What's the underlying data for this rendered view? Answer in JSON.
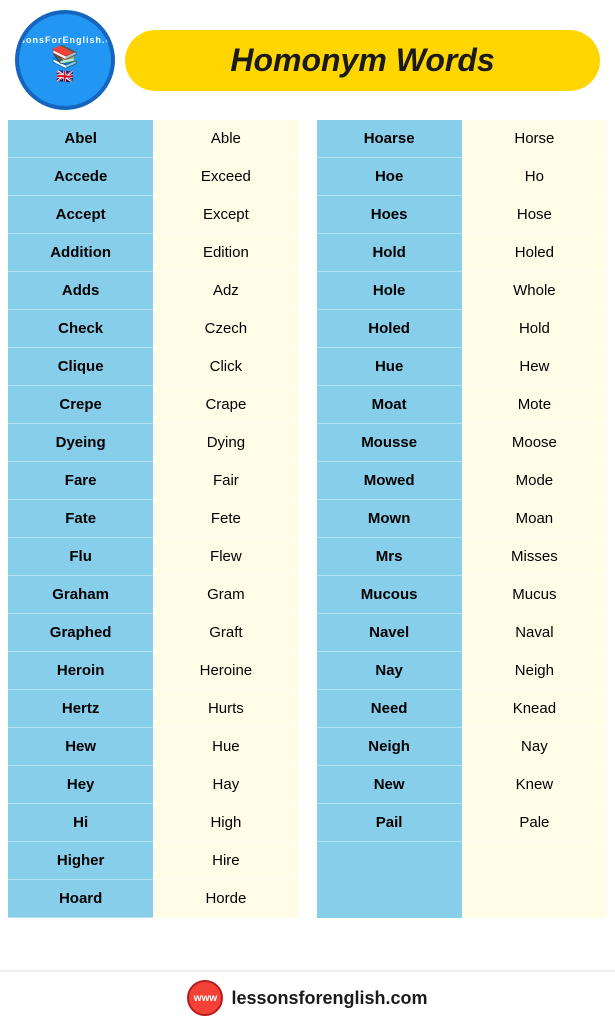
{
  "header": {
    "logo_top": "LessonsForEnglish.Com",
    "title": "Homonym Words",
    "logo_icon": "📚",
    "logo_flag": "🇬🇧"
  },
  "footer": {
    "url": "lessonsforenglish.com",
    "logo_text": "www"
  },
  "left_pair": {
    "column1": [
      "Abel",
      "Accede",
      "Accept",
      "Addition",
      "Adds",
      "Check",
      "Clique",
      "Crepe",
      "Dyeing",
      "Fare",
      "Fate",
      "Flu",
      "Graham",
      "Graphed",
      "Heroin",
      "Hertz",
      "Hew",
      "Hey",
      "Hi",
      "Higher",
      "Hoard"
    ],
    "column2": [
      "Able",
      "Exceed",
      "Except",
      "Edition",
      "Adz",
      "Czech",
      "Click",
      "Crape",
      "Dying",
      "Fair",
      "Fete",
      "Flew",
      "Gram",
      "Graft",
      "Heroine",
      "Hurts",
      "Hue",
      "Hay",
      "High",
      "Hire",
      "Horde"
    ]
  },
  "right_pair": {
    "column1": [
      "Hoarse",
      "Hoe",
      "Hoes",
      "Hold",
      "Hole",
      "Holed",
      "Hue",
      "Moat",
      "Mousse",
      "Mowed",
      "Mown",
      "Mrs",
      "Mucous",
      "Navel",
      "Nay",
      "Need",
      "Neigh",
      "New",
      "Pail"
    ],
    "column2": [
      "Horse",
      "Ho",
      "Hose",
      "Holed",
      "Whole",
      "Hold",
      "Hew",
      "Mote",
      "Moose",
      "Mode",
      "Moan",
      "Misses",
      "Mucus",
      "Naval",
      "Neigh",
      "Knead",
      "Nay",
      "Knew",
      "Pale"
    ]
  }
}
